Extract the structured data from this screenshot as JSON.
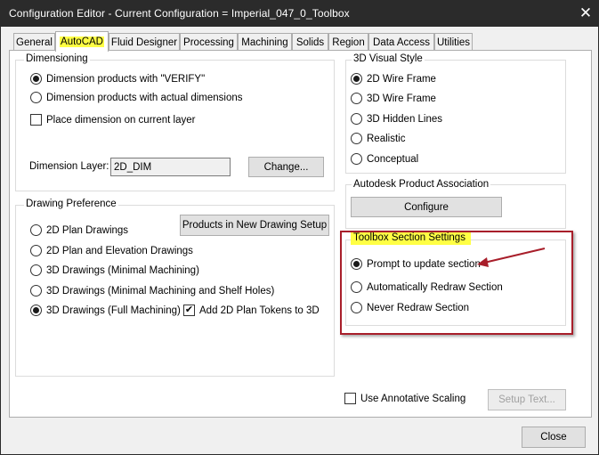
{
  "window": {
    "title": "Configuration Editor - Current Configuration = Imperial_047_0_Toolbox",
    "close_glyph": "✕"
  },
  "tabs": [
    {
      "label": "General"
    },
    {
      "label": "AutoCAD",
      "active": true
    },
    {
      "label": "Fluid Designer"
    },
    {
      "label": "Processing"
    },
    {
      "label": "Machining"
    },
    {
      "label": "Solids"
    },
    {
      "label": "Region"
    },
    {
      "label": "Data Access"
    },
    {
      "label": "Utilities"
    }
  ],
  "dimensioning": {
    "title": "Dimensioning",
    "options": [
      {
        "label": "Dimension products with \"VERIFY\"",
        "selected": true
      },
      {
        "label": "Dimension products with actual dimensions",
        "selected": false
      }
    ],
    "place_on_layer": {
      "label": "Place dimension on current layer",
      "checked": false
    },
    "layer_label": "Dimension Layer:",
    "layer_value": "2D_DIM",
    "change_button": "Change..."
  },
  "visual_style": {
    "title": "3D Visual Style",
    "options": [
      {
        "label": "2D Wire Frame",
        "selected": true
      },
      {
        "label": "3D Wire Frame",
        "selected": false
      },
      {
        "label": "3D Hidden Lines",
        "selected": false
      },
      {
        "label": "Realistic",
        "selected": false
      },
      {
        "label": "Conceptual",
        "selected": false
      }
    ]
  },
  "product_association": {
    "title": "Autodesk Product Association",
    "configure_button": "Configure"
  },
  "drawing_preference": {
    "title": "Drawing Preference",
    "setup_button": "Products in New Drawing Setup",
    "options": [
      {
        "label": "2D Plan Drawings",
        "selected": false
      },
      {
        "label": "2D Plan and Elevation Drawings",
        "selected": false
      },
      {
        "label": "3D Drawings (Minimal Machining)",
        "selected": false
      },
      {
        "label": "3D Drawings (Minimal Machining and Shelf Holes)",
        "selected": false
      },
      {
        "label": "3D Drawings (Full Machining)",
        "selected": true
      }
    ],
    "plan_tokens": {
      "label": "Add 2D Plan Tokens to 3D",
      "checked": true
    }
  },
  "toolbox": {
    "title": "Toolbox Section Settings",
    "options": [
      {
        "label": "Prompt to update section",
        "selected": true
      },
      {
        "label": "Automatically Redraw Section",
        "selected": false
      },
      {
        "label": "Never Redraw Section",
        "selected": false
      }
    ]
  },
  "annotative": {
    "label": "Use Annotative Scaling",
    "checked": false
  },
  "setup_text_button": "Setup Text...",
  "close_button": "Close",
  "colors": {
    "highlight": "#ffff44",
    "annotation": "#a81e2a",
    "titlebar": "#2b2b2b"
  }
}
